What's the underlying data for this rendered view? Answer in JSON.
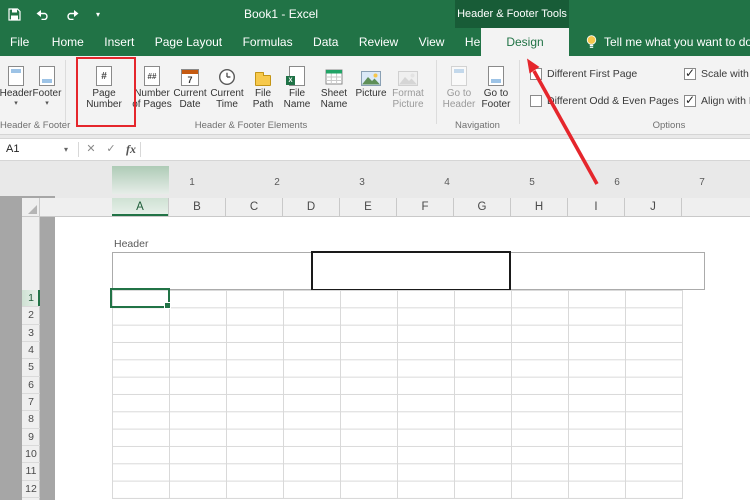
{
  "titlebar": {
    "title": "Book1  -  Excel",
    "contextual_tools": "Header & Footer Tools"
  },
  "tabs": {
    "items": [
      "File",
      "Home",
      "Insert",
      "Page Layout",
      "Formulas",
      "Data",
      "Review",
      "View",
      "Help"
    ],
    "design": "Design",
    "tell_me": "Tell me what you want to do"
  },
  "icons": {
    "caret_down": "▾"
  },
  "ribbon": {
    "header_footer": {
      "label": "Header & Footer",
      "header": "Header",
      "footer": "Footer"
    },
    "elements": {
      "label": "Header & Footer Elements",
      "page_number": {
        "line1": "Page",
        "line2": "Number",
        "glyph": "#"
      },
      "number_of_pages": {
        "line1": "Number",
        "line2": "of Pages",
        "glyph": "##"
      },
      "current_date": {
        "line1": "Current",
        "line2": "Date",
        "day": "7"
      },
      "current_time": {
        "line1": "Current",
        "line2": "Time"
      },
      "file_path": {
        "line1": "File",
        "line2": "Path"
      },
      "file_name": {
        "line1": "File",
        "line2": "Name"
      },
      "sheet_name": {
        "line1": "Sheet",
        "line2": "Name"
      },
      "picture": {
        "line1": "Picture",
        "line2": ""
      },
      "format_picture": {
        "line1": "Format",
        "line2": "Picture"
      }
    },
    "navigation": {
      "label": "Navigation",
      "go_to_header": {
        "line1": "Go to",
        "line2": "Header"
      },
      "go_to_footer": {
        "line1": "Go to",
        "line2": "Footer"
      }
    },
    "options": {
      "label": "Options",
      "different_first_page": {
        "label": "Different First Page",
        "checked": false
      },
      "different_odd_even": {
        "label": "Different Odd & Even Pages",
        "checked": false
      },
      "scale_with_document": {
        "label": "Scale with Document",
        "checked": true
      },
      "align_with_margins": {
        "label": "Align with Page Margins",
        "checked": true
      }
    }
  },
  "formula_bar": {
    "name_box": "A1",
    "cancel": "✕",
    "enter": "✓",
    "insert_function": "fx",
    "formula": ""
  },
  "ruler": {
    "marks": [
      "1",
      "2",
      "3",
      "4",
      "5",
      "6",
      "7"
    ]
  },
  "sheet": {
    "header_label": "Header",
    "columns": [
      "A",
      "B",
      "C",
      "D",
      "E",
      "F",
      "G",
      "H",
      "I",
      "J"
    ],
    "rows": [
      "1",
      "2",
      "3",
      "4",
      "5",
      "6",
      "7",
      "8",
      "9",
      "10",
      "11",
      "12"
    ],
    "selected_cell": "A1"
  },
  "colors": {
    "titlebar_green": "#217346",
    "contextual_green": "#185C37",
    "selection_green": "#217346",
    "annotation_red": "#E5262C"
  }
}
